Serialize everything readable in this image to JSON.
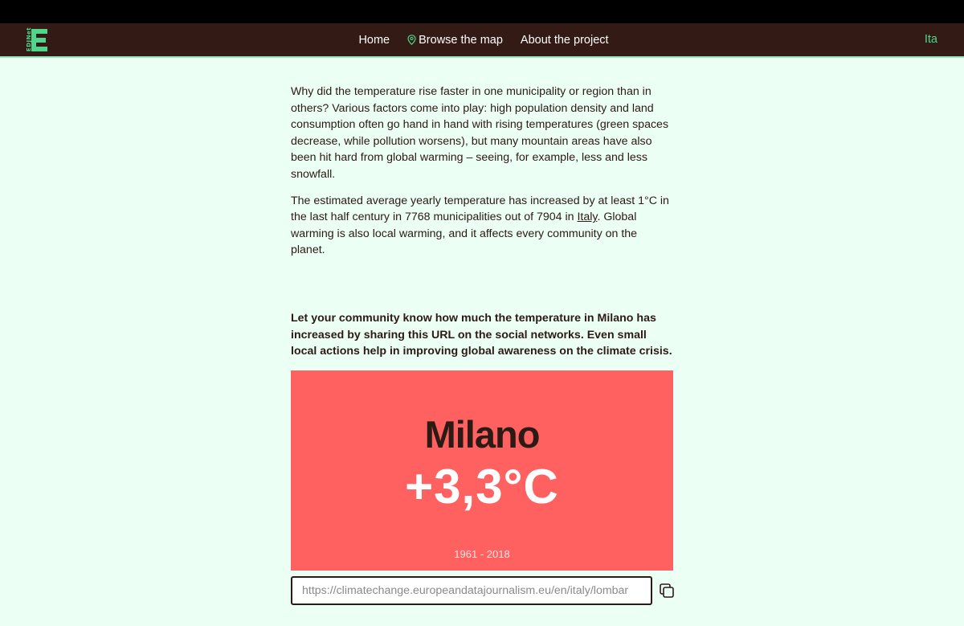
{
  "nav": {
    "logo_text": "EDJNet",
    "links": [
      "Home",
      "Browse the map",
      "About the project"
    ],
    "language": "Ita"
  },
  "intro": {
    "paragraph1": "Why did the temperature rise faster in one municipality or region than in others? Various factors come into play: high population density and land consumption often go hand in hand with rising temperatures (green spaces decrease, while pollution worsens), but many mountain areas have also been hit hard from global warming – seeing, for example, less and less snowfall.",
    "paragraph2_before": "The estimated average yearly temperature has increased by at least 1°C in the last half century in 7768 municipalities out of 7904 in ",
    "paragraph2_link": "Italy",
    "paragraph2_after": ". Global warming is also local warming, and it affects every community on the planet."
  },
  "share": {
    "prompt": "Let your community know how much the temperature in Milano has increased by sharing this URL on the social networks. Even small local actions help in improving global awareness on the climate crisis.",
    "card": {
      "city": "Milano",
      "temperature_change": "+3,3°C",
      "period": "1961 - 2018",
      "background_color": "#ff6161"
    },
    "url_value": "https://climatechange.europeandatajournalism.eu/en/italy/lombar",
    "copy_icon": "copy-icon"
  },
  "colors": {
    "page_background": "#ebfff4",
    "nav_background": "#341a15",
    "accent_green": "#4ed68c",
    "text_dark": "#2c1a14"
  }
}
